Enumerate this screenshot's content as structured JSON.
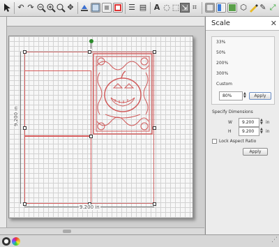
{
  "toolbar": {
    "icons": [
      "pointer-icon",
      "undo-icon",
      "redo-icon",
      "zoom-out-icon",
      "zoom-in-icon",
      "zoom-fit-icon",
      "pan-icon",
      "fill-icon",
      "mat-view-icon",
      "preview-icon",
      "color-icon",
      "align-icon",
      "distribute-icon",
      "text-icon",
      "contour-icon",
      "weld-icon",
      "scale-icon",
      "path-icon",
      "group-icon",
      "ungroup-icon",
      "pen-icon",
      "knife-icon",
      "scissors-icon",
      "arrow-icon"
    ]
  },
  "canvas": {
    "width_label": "9.200 in",
    "height_label": "9.200 in",
    "design_name": "jack-o-lantern"
  },
  "panel": {
    "title": "Scale",
    "close": "✕",
    "presets": [
      "33%",
      "50%",
      "200%",
      "300%"
    ],
    "custom_label": "Custom",
    "custom_value": "80%",
    "apply_label": "Apply",
    "specify_label": "Specify Dimensions",
    "w_label": "W",
    "h_label": "H",
    "w_value": "9.200",
    "h_value": "9.200",
    "unit": "in",
    "lock_label": "Lock Aspect Ratio",
    "apply2_label": "Apply"
  },
  "colors": {
    "design": "#d05a5a",
    "accent": "#2b6cd6"
  }
}
